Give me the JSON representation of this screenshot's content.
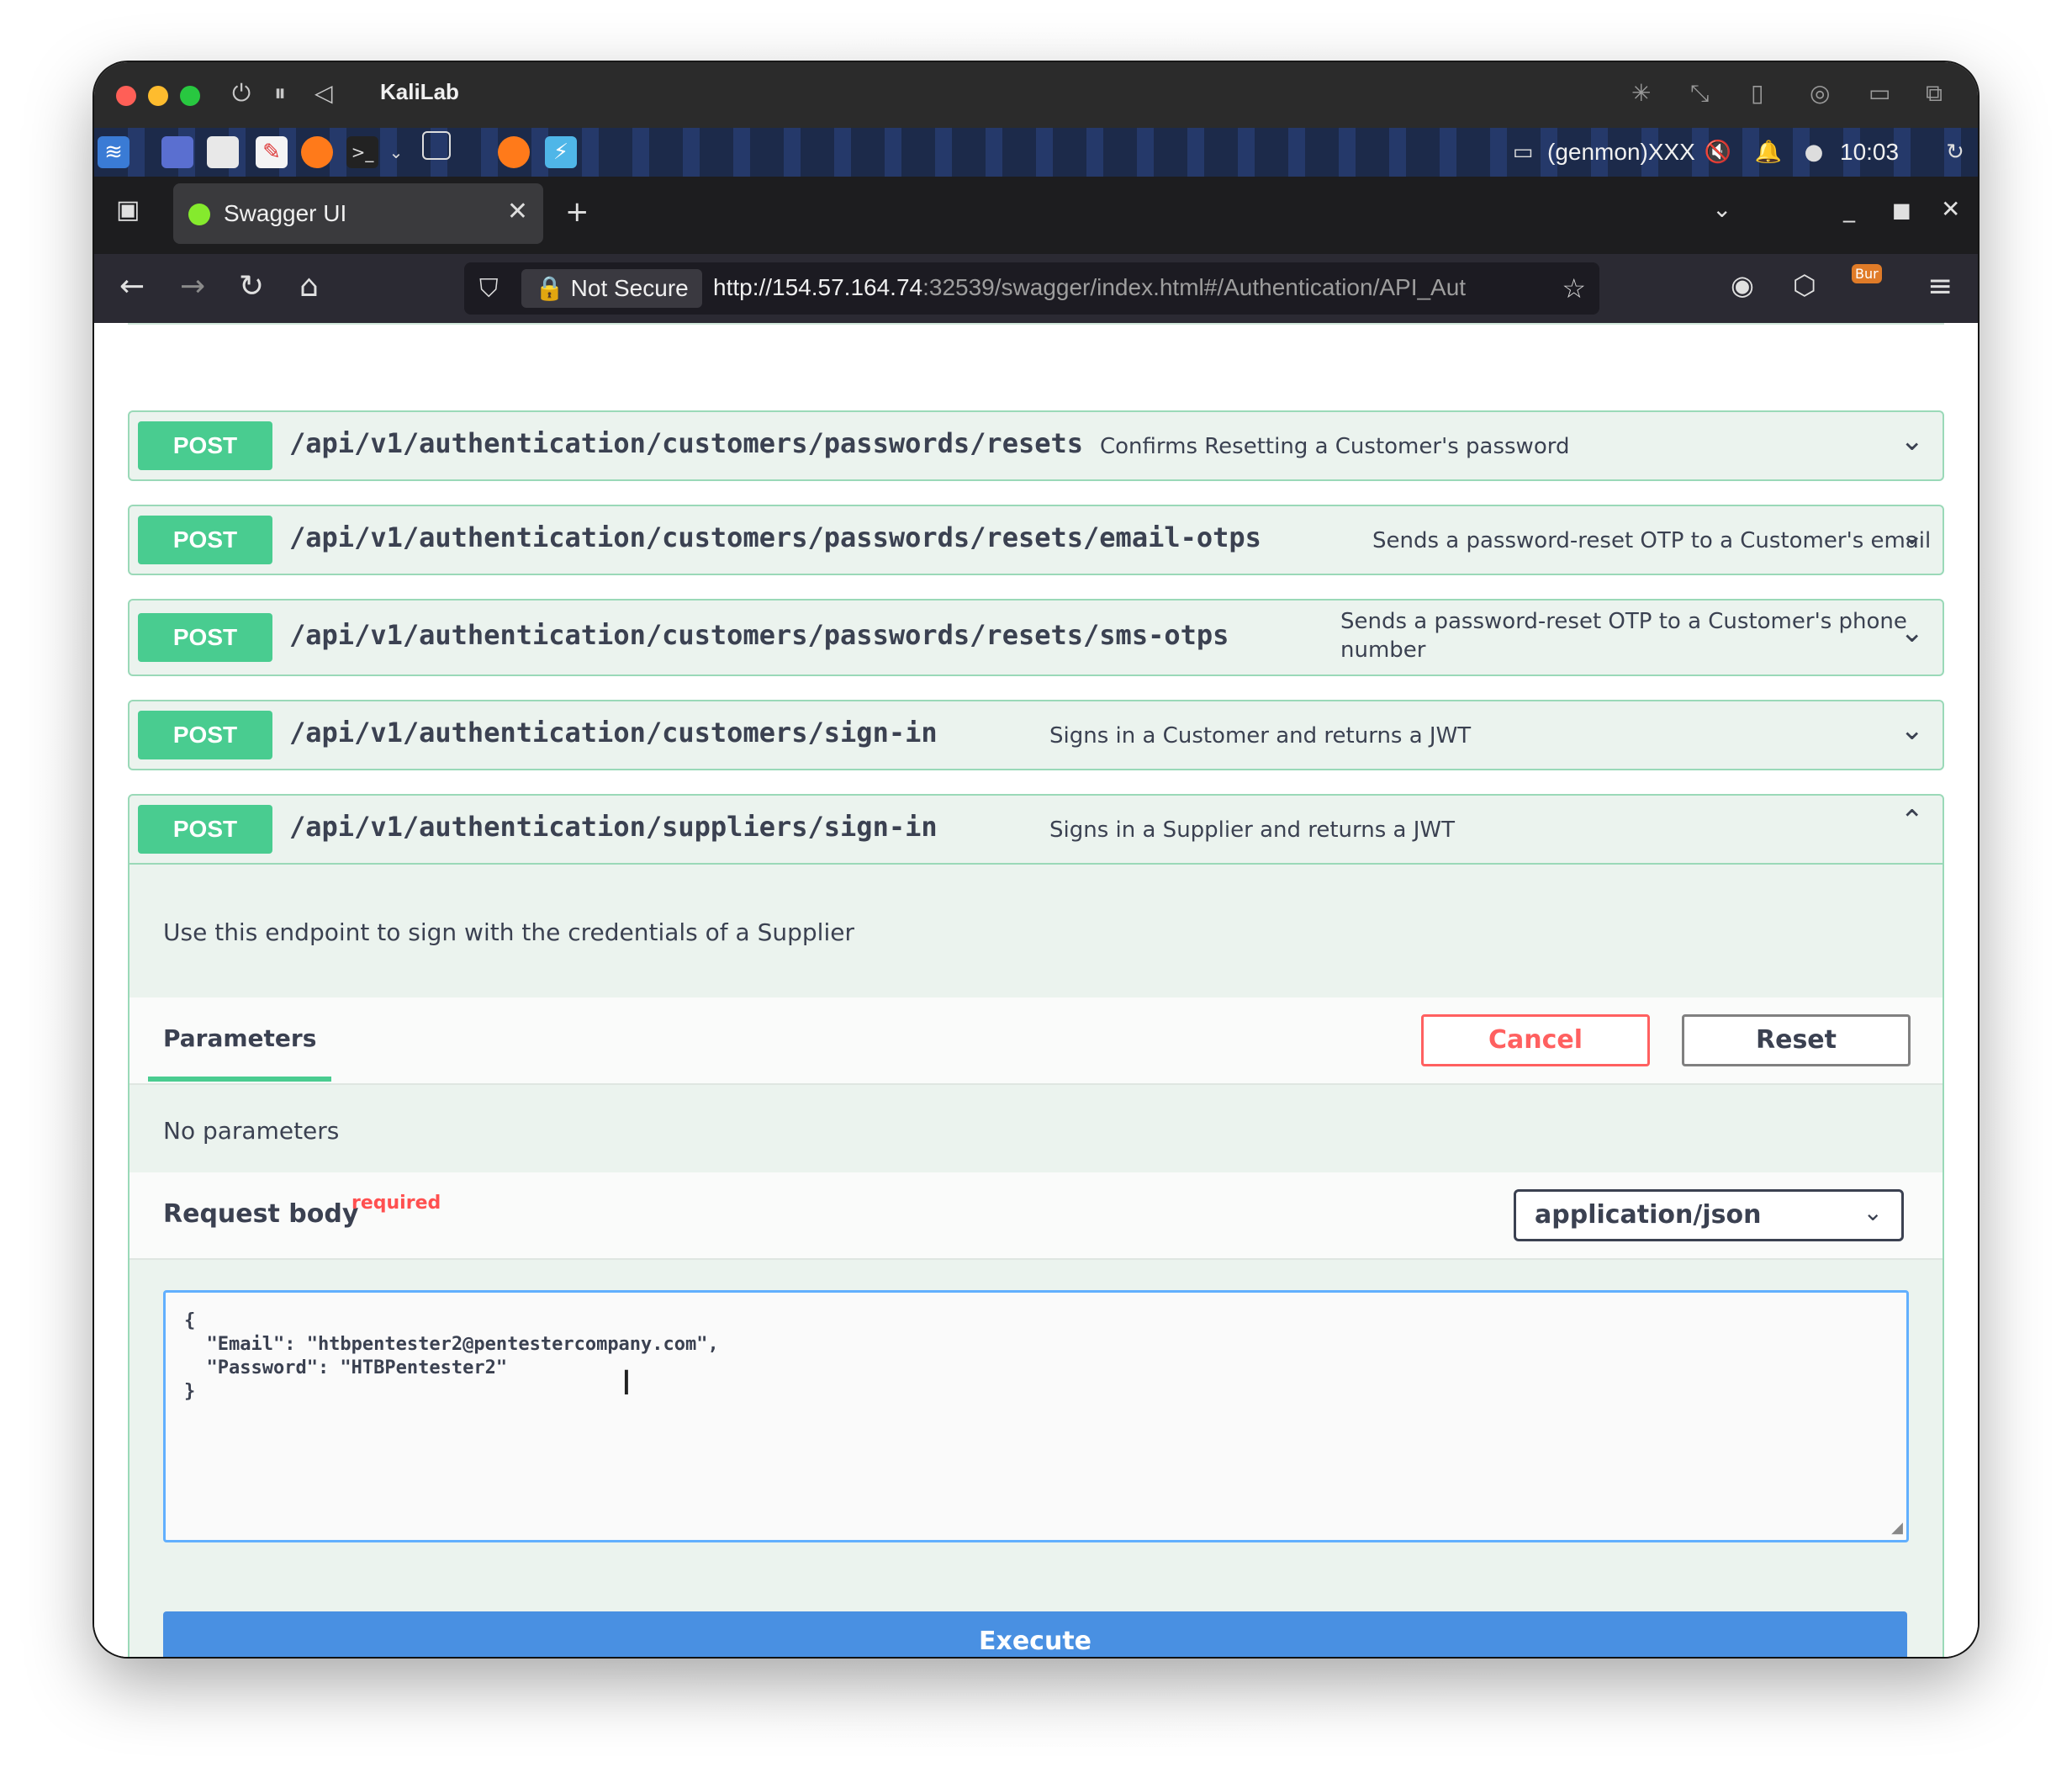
{
  "mac": {
    "title": "KaliLab",
    "controls": [
      "power-icon",
      "pause-icon",
      "back-triangle-icon"
    ],
    "right_icons": [
      "brightness-icon",
      "resize-icon",
      "usb-icon",
      "network-icon",
      "folder-icon",
      "window-icon"
    ]
  },
  "panel": {
    "status_text": "(genmon)XXX",
    "time": "10:03"
  },
  "browser": {
    "tab_title": "Swagger UI",
    "tab_close": "✕",
    "new_tab": "+",
    "not_secure": "Not Secure",
    "url_host": "http://154.57.164.74",
    "url_rest": ":32539/swagger/index.html#/Authentication/API_Aut",
    "burp_badge": "Bur"
  },
  "operations": [
    {
      "method": "POST",
      "path": "/api/v1/authentication/customers/passwords/resets",
      "summary": "Confirms Resetting a Customer's password",
      "expanded": false
    },
    {
      "method": "POST",
      "path": "/api/v1/authentication/customers/passwords/resets/email-otps",
      "summary": "Sends a password-reset OTP to a Customer's email",
      "expanded": false
    },
    {
      "method": "POST",
      "path": "/api/v1/authentication/customers/passwords/resets/sms-otps",
      "summary_line1": "Sends a password-reset OTP to a Customer's phone",
      "summary_line2": "number",
      "expanded": false
    },
    {
      "method": "POST",
      "path": "/api/v1/authentication/customers/sign-in",
      "summary": "Signs in a Customer and returns a JWT",
      "expanded": false
    },
    {
      "method": "POST",
      "path": "/api/v1/authentication/suppliers/sign-in",
      "summary": "Signs in a Supplier and returns a JWT",
      "expanded": true
    }
  ],
  "expanded_op": {
    "description": "Use this endpoint to sign with the credentials of a Supplier",
    "parameters_tab": "Parameters",
    "cancel_label": "Cancel",
    "reset_label": "Reset",
    "no_parameters": "No parameters",
    "request_body_label": "Request body",
    "required_label": "required",
    "content_type": "application/json",
    "body_text": "{\n  \"Email\": \"htbpentester2@pentestercompany.com\",\n  \"Password\": \"HTBPentester2\"\n}",
    "execute_label": "Execute"
  },
  "colors": {
    "post_green": "#49cc90",
    "execute_blue": "#4990e2",
    "cancel_red": "#ff6060"
  }
}
